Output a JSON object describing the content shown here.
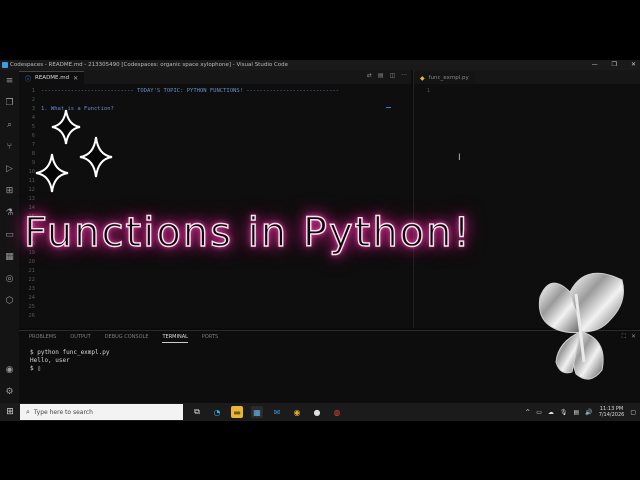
{
  "window": {
    "title": "Codespaces - README.md - 213305490 [Codespaces: organic space xylophone] - Visual Studio Code",
    "controls": [
      "—",
      "❐",
      "✕"
    ]
  },
  "editor_left": {
    "tab_label": "README.md",
    "lines": [
      {
        "n": "1",
        "text": "---------------------------- TODAY'S TOPIC: PYTHON FUNCTIONS! ----------------------------"
      },
      {
        "n": "2",
        "text": ""
      },
      {
        "n": "3",
        "text": "1. What is a Function?"
      },
      {
        "n": "4",
        "text": ""
      },
      {
        "n": "5",
        "text": ""
      },
      {
        "n": "6",
        "text": ""
      },
      {
        "n": "7",
        "text": ""
      },
      {
        "n": "8",
        "text": ""
      },
      {
        "n": "9",
        "text": ""
      },
      {
        "n": "10",
        "text": ""
      },
      {
        "n": "11",
        "text": ""
      },
      {
        "n": "12",
        "text": ""
      },
      {
        "n": "13",
        "text": ""
      },
      {
        "n": "14",
        "text": ""
      },
      {
        "n": "15",
        "text": ""
      },
      {
        "n": "16",
        "text": ""
      },
      {
        "n": "17",
        "text": ""
      },
      {
        "n": "18",
        "text": ""
      },
      {
        "n": "19",
        "text": ""
      },
      {
        "n": "20",
        "text": ""
      },
      {
        "n": "21",
        "text": ""
      },
      {
        "n": "22",
        "text": ""
      },
      {
        "n": "23",
        "text": ""
      },
      {
        "n": "24",
        "text": ""
      },
      {
        "n": "25",
        "text": ""
      },
      {
        "n": "26",
        "text": ""
      }
    ]
  },
  "editor_right": {
    "tab_label": "func_exmpl.py",
    "lines": [
      {
        "n": "1",
        "text": ""
      }
    ]
  },
  "panel": {
    "tabs": [
      "PROBLEMS",
      "OUTPUT",
      "DEBUG CONSOLE",
      "TERMINAL",
      "PORTS"
    ],
    "active_tab": "TERMINAL",
    "terminal_lines": [
      "$ python func_exmpl.py",
      "Hello, user",
      "$ ▯"
    ]
  },
  "overlay": {
    "title": "Functions in Python!"
  },
  "taskbar": {
    "search_placeholder": "Type here to search",
    "time": "11:13 PM",
    "date": "7/14/2026"
  },
  "colors": {
    "accent": "#ff2aa5",
    "code_text": "#6b8cc7",
    "file_icon": "#4aa3ff"
  }
}
